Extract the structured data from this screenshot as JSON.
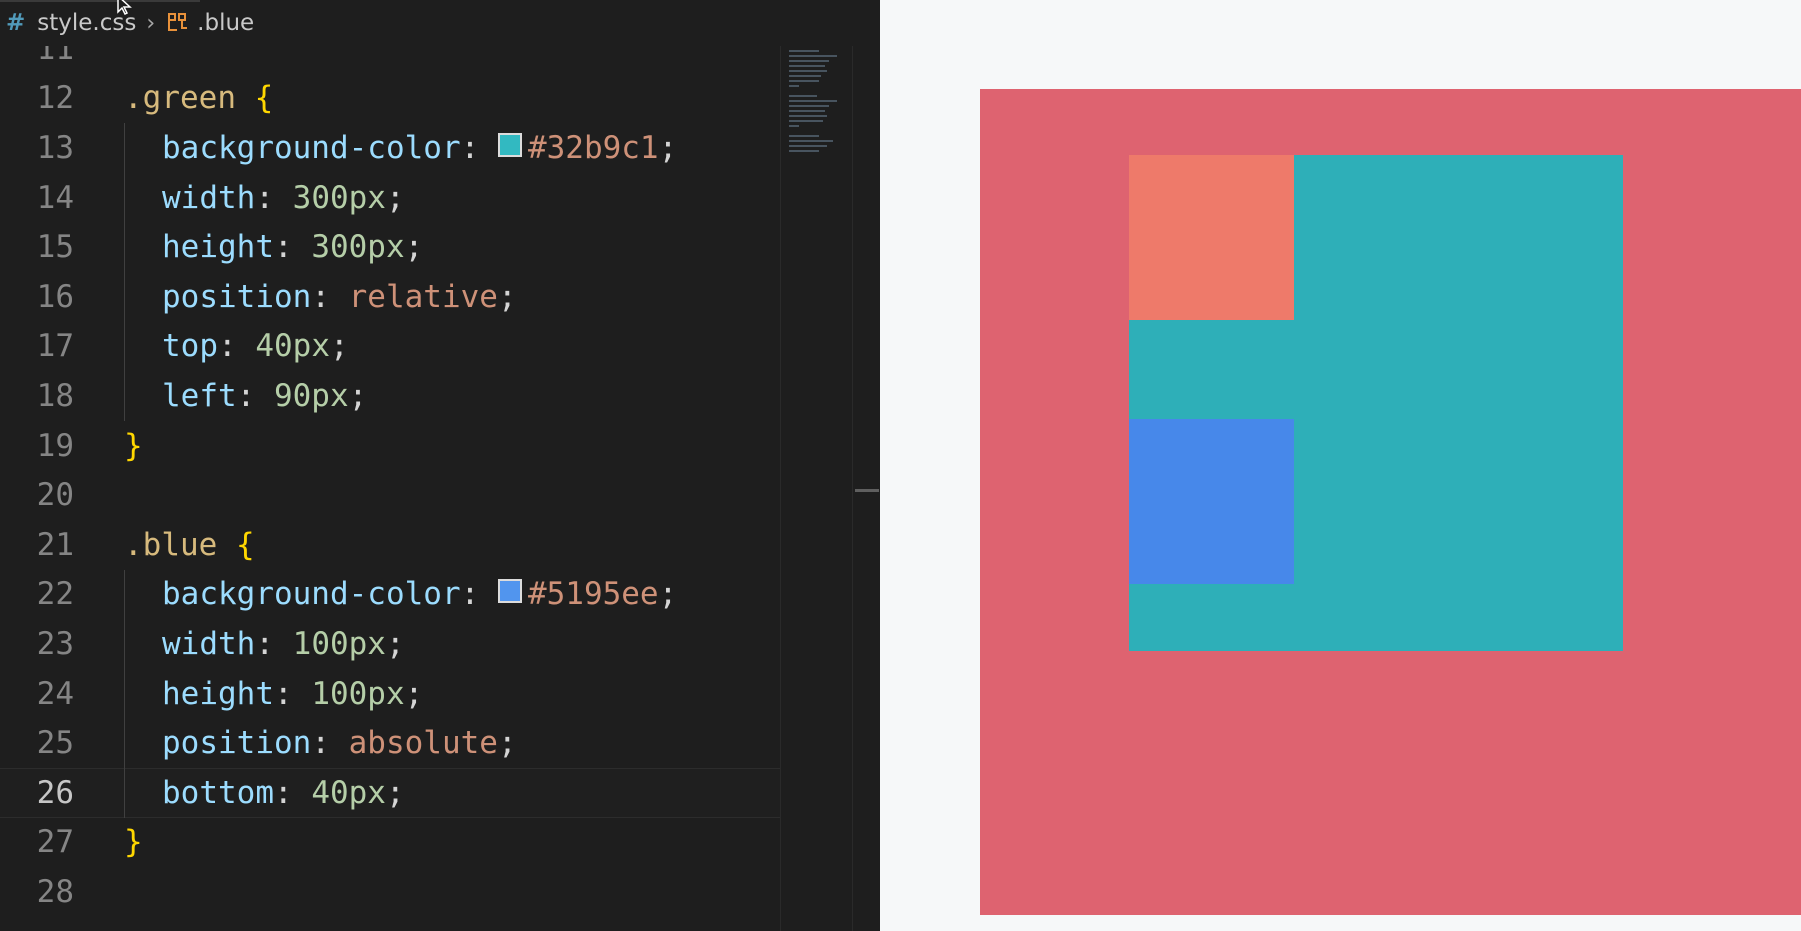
{
  "breadcrumb": {
    "file": "style.css",
    "symbol": ".blue",
    "file_icon": "hash-icon",
    "symbol_icon": "css-selector-icon"
  },
  "lines": [
    {
      "n": "11",
      "tokens": []
    },
    {
      "n": "12",
      "tokens": [
        {
          "t": ".green",
          "c": "c-sel"
        },
        {
          "t": " "
        },
        {
          "t": "{",
          "c": "c-brace"
        }
      ]
    },
    {
      "n": "13",
      "indent": 1,
      "tokens": [
        {
          "t": "background-color",
          "c": "c-prop"
        },
        {
          "t": ": ",
          "c": "c-punc"
        },
        {
          "swatch": "#32b9c1"
        },
        {
          "t": "#32b9c1",
          "c": "c-val"
        },
        {
          "t": ";",
          "c": "c-punc"
        }
      ]
    },
    {
      "n": "14",
      "indent": 1,
      "tokens": [
        {
          "t": "width",
          "c": "c-prop"
        },
        {
          "t": ": ",
          "c": "c-punc"
        },
        {
          "t": "300px",
          "c": "c-num"
        },
        {
          "t": ";",
          "c": "c-punc"
        }
      ]
    },
    {
      "n": "15",
      "indent": 1,
      "tokens": [
        {
          "t": "height",
          "c": "c-prop"
        },
        {
          "t": ": ",
          "c": "c-punc"
        },
        {
          "t": "300px",
          "c": "c-num"
        },
        {
          "t": ";",
          "c": "c-punc"
        }
      ]
    },
    {
      "n": "16",
      "indent": 1,
      "tokens": [
        {
          "t": "position",
          "c": "c-prop"
        },
        {
          "t": ": ",
          "c": "c-punc"
        },
        {
          "t": "relative",
          "c": "c-val"
        },
        {
          "t": ";",
          "c": "c-punc"
        }
      ]
    },
    {
      "n": "17",
      "indent": 1,
      "tokens": [
        {
          "t": "top",
          "c": "c-prop"
        },
        {
          "t": ": ",
          "c": "c-punc"
        },
        {
          "t": "40px",
          "c": "c-num"
        },
        {
          "t": ";",
          "c": "c-punc"
        }
      ]
    },
    {
      "n": "18",
      "indent": 1,
      "tokens": [
        {
          "t": "left",
          "c": "c-prop"
        },
        {
          "t": ": ",
          "c": "c-punc"
        },
        {
          "t": "90px",
          "c": "c-num"
        },
        {
          "t": ";",
          "c": "c-punc"
        }
      ]
    },
    {
      "n": "19",
      "tokens": [
        {
          "t": "}",
          "c": "c-brace"
        }
      ]
    },
    {
      "n": "20",
      "tokens": []
    },
    {
      "n": "21",
      "tokens": [
        {
          "t": ".blue",
          "c": "c-sel"
        },
        {
          "t": " "
        },
        {
          "t": "{",
          "c": "c-brace"
        }
      ]
    },
    {
      "n": "22",
      "indent": 1,
      "tokens": [
        {
          "t": "background-color",
          "c": "c-prop"
        },
        {
          "t": ": ",
          "c": "c-punc"
        },
        {
          "swatch": "#5195ee"
        },
        {
          "t": "#5195ee",
          "c": "c-val"
        },
        {
          "t": ";",
          "c": "c-punc"
        }
      ]
    },
    {
      "n": "23",
      "indent": 1,
      "tokens": [
        {
          "t": "width",
          "c": "c-prop"
        },
        {
          "t": ": ",
          "c": "c-punc"
        },
        {
          "t": "100px",
          "c": "c-num"
        },
        {
          "t": ";",
          "c": "c-punc"
        }
      ]
    },
    {
      "n": "24",
      "indent": 1,
      "tokens": [
        {
          "t": "height",
          "c": "c-prop"
        },
        {
          "t": ": ",
          "c": "c-punc"
        },
        {
          "t": "100px",
          "c": "c-num"
        },
        {
          "t": ";",
          "c": "c-punc"
        }
      ]
    },
    {
      "n": "25",
      "indent": 1,
      "tokens": [
        {
          "t": "position",
          "c": "c-prop"
        },
        {
          "t": ": ",
          "c": "c-punc"
        },
        {
          "t": "absolute",
          "c": "c-val"
        },
        {
          "t": ";",
          "c": "c-punc"
        }
      ]
    },
    {
      "n": "26",
      "indent": 1,
      "active": true,
      "tokens": [
        {
          "t": "bottom",
          "c": "c-prop"
        },
        {
          "t": ": ",
          "c": "c-punc"
        },
        {
          "t": "40px",
          "c": "c-num"
        },
        {
          "t": ";",
          "c": "c-punc"
        }
      ]
    },
    {
      "n": "27",
      "tokens": [
        {
          "t": "}",
          "c": "c-brace"
        }
      ]
    },
    {
      "n": "28",
      "tokens": []
    }
  ],
  "preview": {
    "red_color": "#de6370",
    "green_color": "#2eafb8",
    "orange_color": "#ee7a6a",
    "blue_color": "#4788ea"
  },
  "theme": {
    "editor_bg": "#1e1e1e",
    "preview_bg": "#f6f8f9"
  }
}
